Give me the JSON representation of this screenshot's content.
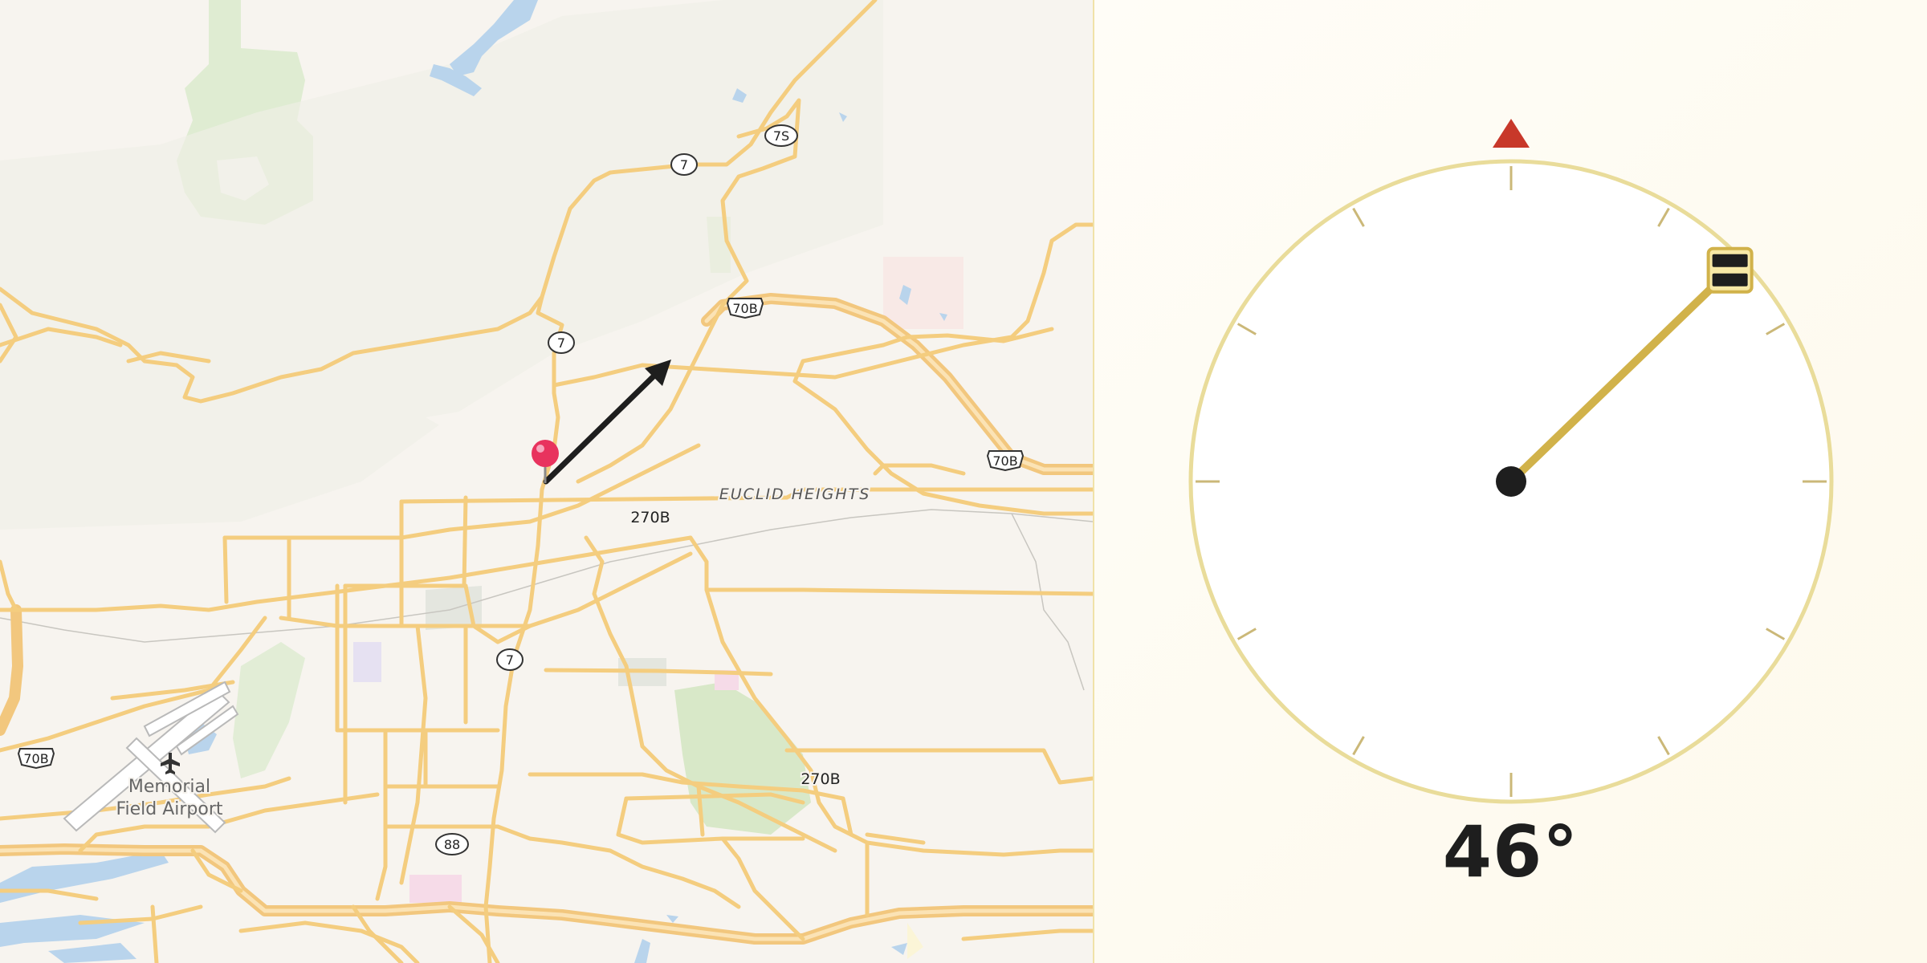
{
  "map": {
    "route_shields": {
      "shield_7_north": "7",
      "shield_7s": "7S",
      "shield_70b_center": "70B",
      "shield_7_mid": "7",
      "shield_70b_east": "70B",
      "shield_7_south": "7",
      "shield_70b_west": "70B",
      "shield_88": "88"
    },
    "road_labels": {
      "label_270b_north": "270B",
      "label_270b_south": "270B"
    },
    "area_labels": {
      "neighborhood": "EUCLID HEIGHTS",
      "airport_line1": "Memorial",
      "airport_line2": "Field Airport"
    },
    "marker": {
      "color": "#e8335e"
    },
    "direction_arrow": {
      "color": "#1e1e1e"
    }
  },
  "compass": {
    "bearing_degrees": 46,
    "bearing_text": "46°",
    "north_marker_color": "#c8382a",
    "needle_color": "#d1b24a",
    "ring_color": "#e9dc9a"
  }
}
